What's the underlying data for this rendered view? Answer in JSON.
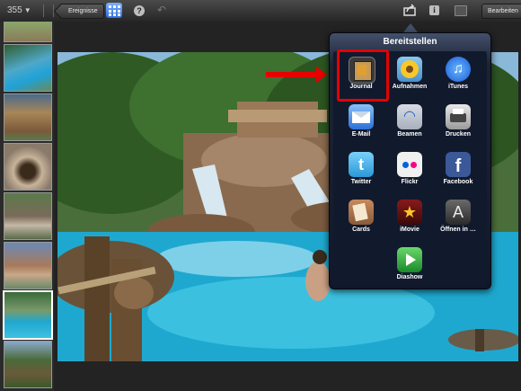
{
  "toolbar": {
    "photo_count": "355",
    "back_label": "Ereignisse",
    "edit_label": "Bearbeiten",
    "icons": [
      "grid-icon",
      "help-icon",
      "undo-icon",
      "share-icon",
      "info-icon",
      "hide-panel-icon"
    ]
  },
  "share_popover": {
    "title": "Bereitstellen",
    "items": [
      {
        "label": "Journal",
        "icon": "journal-icon",
        "highlighted": true
      },
      {
        "label": "Aufnahmen",
        "icon": "sunflower-icon"
      },
      {
        "label": "iTunes",
        "icon": "itunes-icon"
      },
      {
        "label": "E-Mail",
        "icon": "mail-icon"
      },
      {
        "label": "Beamen",
        "icon": "wifi-icon"
      },
      {
        "label": "Drucken",
        "icon": "printer-icon"
      },
      {
        "label": "Twitter",
        "icon": "twitter-icon"
      },
      {
        "label": "Flickr",
        "icon": "flickr-icon"
      },
      {
        "label": "Facebook",
        "icon": "facebook-icon"
      },
      {
        "label": "Cards",
        "icon": "cards-icon"
      },
      {
        "label": "iMovie",
        "icon": "imovie-icon"
      },
      {
        "label": "Öffnen in …",
        "icon": "app-store-icon"
      },
      {
        "label": "Diashow",
        "icon": "play-icon"
      }
    ]
  },
  "colors": {
    "highlight": "#e60000",
    "accent": "#2d6fe0"
  }
}
